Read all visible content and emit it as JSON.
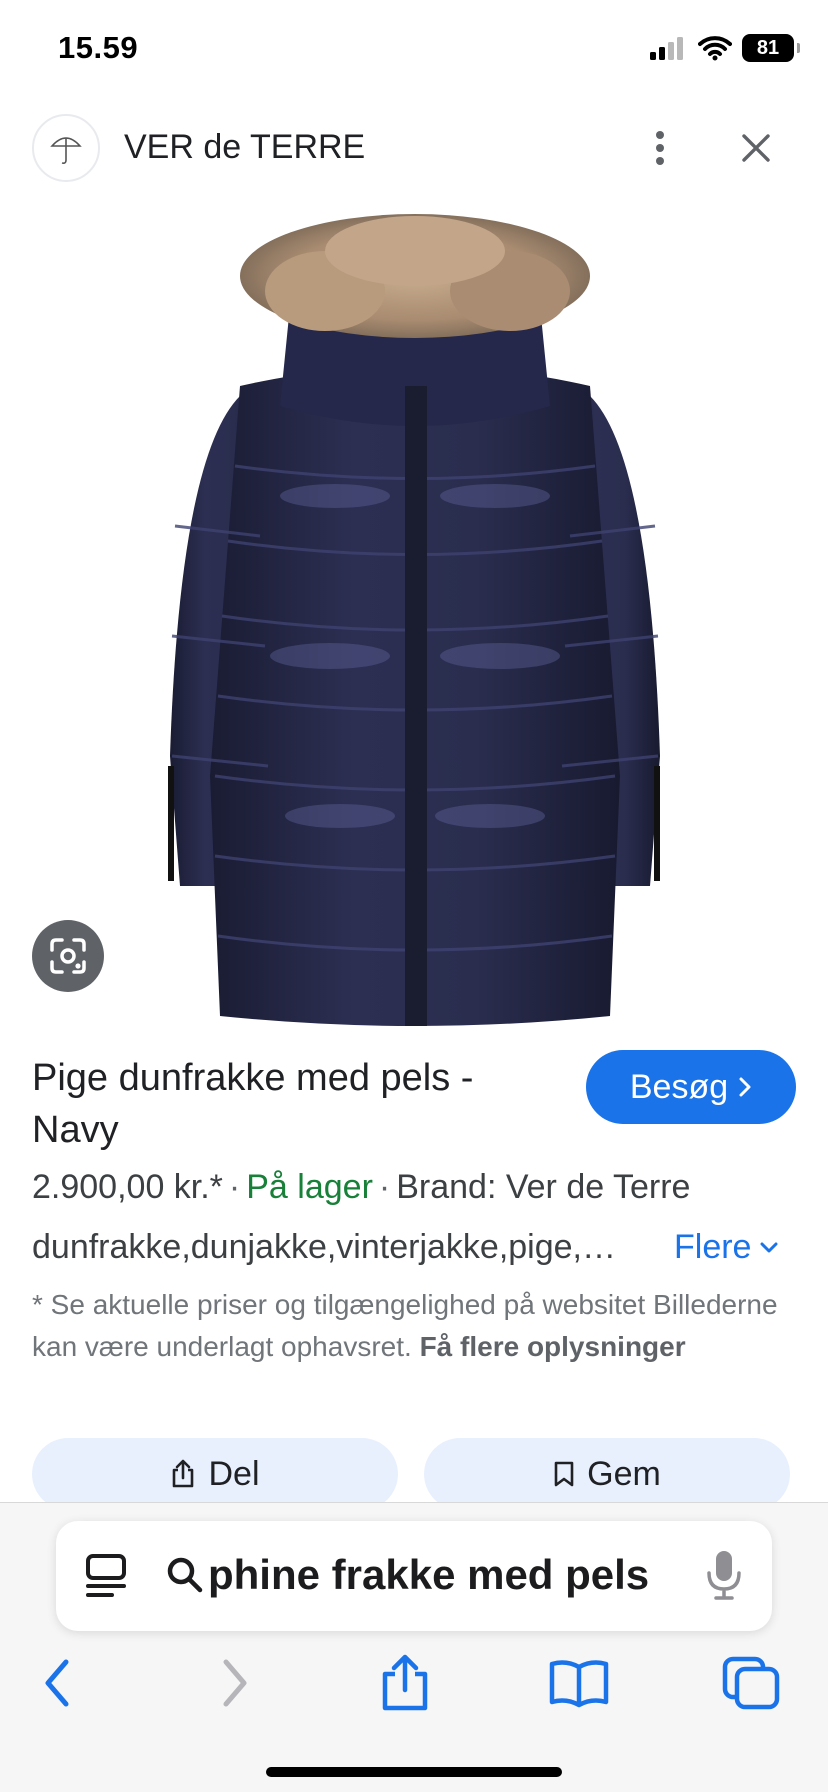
{
  "status_bar": {
    "time": "15.59",
    "battery": "81"
  },
  "header": {
    "site_name": "VER de TERRE"
  },
  "product": {
    "title": "Pige dunfrakke med pels - Navy",
    "visit_label": "Besøg",
    "price": "2.900,00 kr.*",
    "stock": "På lager",
    "brand": "Brand: Ver de Terre",
    "tags": "dunfrakke,dunjakke,vinterjakke,pige,…",
    "more_label": "Flere",
    "disclaimer": "* Se aktuelle priser og tilgængelighed på websitet Billederne kan være underlagt ophavsret.",
    "disclaimer_link": "Få flere oplysninger"
  },
  "actions": {
    "share_label": "Del",
    "save_label": "Gem"
  },
  "browser": {
    "address": "phine frakke med pels"
  },
  "colors": {
    "accent": "#1a73e8",
    "stock": "#188038",
    "coat": "#23253f",
    "chip": "#e8f0fe"
  },
  "icons": [
    "signal-icon",
    "wifi-icon",
    "battery-icon",
    "site-logo-icon",
    "more-vert-icon",
    "close-icon",
    "lens-icon",
    "chevron-right-icon",
    "chevron-down-icon",
    "share-icon",
    "bookmark-icon",
    "reader-icon",
    "search-icon",
    "mic-icon",
    "back-icon",
    "forward-icon",
    "safari-share-icon",
    "book-icon",
    "tabs-icon"
  ]
}
